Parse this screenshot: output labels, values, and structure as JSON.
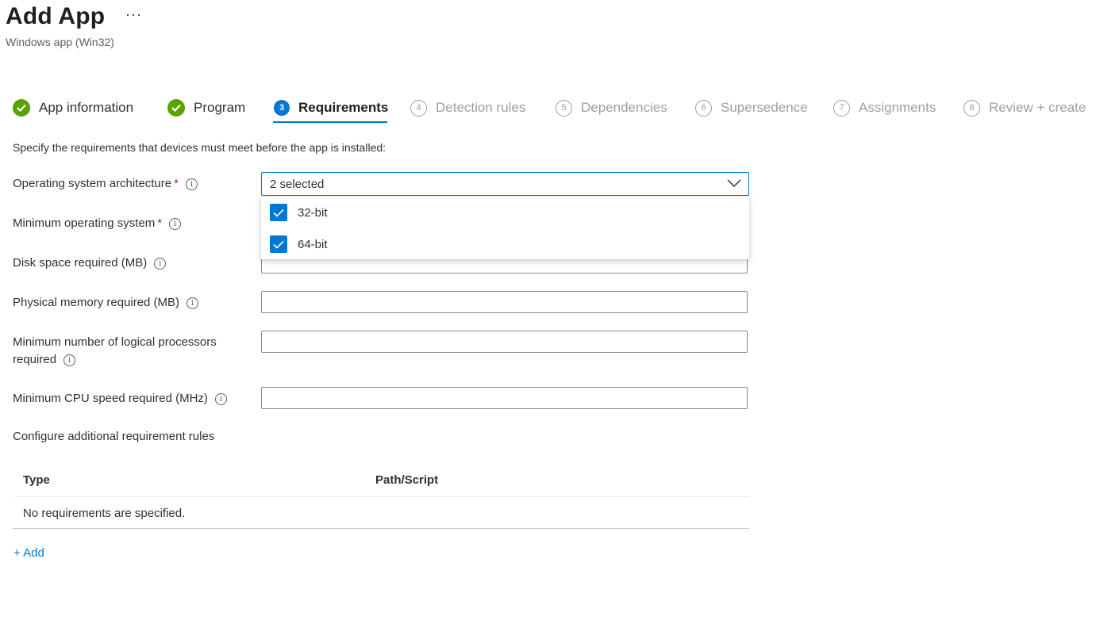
{
  "header": {
    "title": "Add App",
    "more_label": "···",
    "subtitle": "Windows app (Win32)"
  },
  "steps": [
    {
      "label": "App information",
      "status": "complete",
      "icon": "check-icon"
    },
    {
      "label": "Program",
      "status": "complete",
      "icon": "check-icon"
    },
    {
      "number": "3",
      "label": "Requirements",
      "status": "current"
    },
    {
      "number": "4",
      "label": "Detection rules",
      "status": "upcoming"
    },
    {
      "number": "5",
      "label": "Dependencies",
      "status": "upcoming"
    },
    {
      "number": "6",
      "label": "Supersedence",
      "status": "upcoming"
    },
    {
      "number": "7",
      "label": "Assignments",
      "status": "upcoming"
    },
    {
      "number": "8",
      "label": "Review + create",
      "status": "upcoming"
    }
  ],
  "form": {
    "intro": "Specify the requirements that devices must meet before the app is installed:",
    "required_marker": "*",
    "info_glyph": "i",
    "os_architecture": {
      "label": "Operating system architecture",
      "value": "2 selected",
      "options": [
        {
          "label": "32-bit",
          "checked": true
        },
        {
          "label": "64-bit",
          "checked": true
        }
      ]
    },
    "min_os": {
      "label": "Minimum operating system",
      "value": ""
    },
    "disk_space": {
      "label": "Disk space required (MB)",
      "value": ""
    },
    "physical_memory": {
      "label": "Physical memory required (MB)",
      "value": ""
    },
    "logical_processors": {
      "label_line1": "Minimum number of logical processors",
      "label_line2": "required",
      "value": ""
    },
    "cpu_speed": {
      "label": "Minimum CPU speed required (MHz)",
      "value": ""
    }
  },
  "rules": {
    "title": "Configure additional requirement rules",
    "columns": [
      "Type",
      "Path/Script"
    ],
    "empty_text": "No requirements are specified.",
    "add_label": "+ Add"
  },
  "colors": {
    "accent": "#0078d4",
    "complete": "#57a300",
    "required": "#a4262c"
  }
}
